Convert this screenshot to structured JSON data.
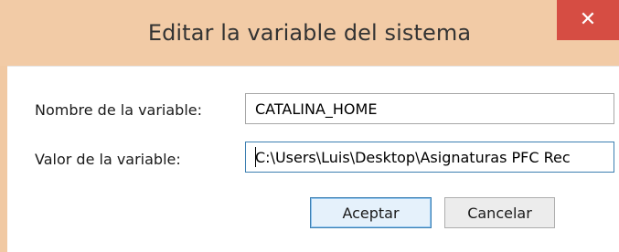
{
  "window": {
    "title": "Editar la variable del sistema",
    "close_glyph": "✕",
    "titlebar_color": "#f2cba6",
    "close_color": "#d64d43"
  },
  "form": {
    "name_label": "Nombre de la variable:",
    "name_value": "CATALINA_HOME",
    "value_label": "Valor de la variable:",
    "value_value": "C:\\Users\\Luis\\Desktop\\Asignaturas PFC Rec"
  },
  "buttons": {
    "accept_label": "Aceptar",
    "cancel_label": "Cancelar"
  }
}
